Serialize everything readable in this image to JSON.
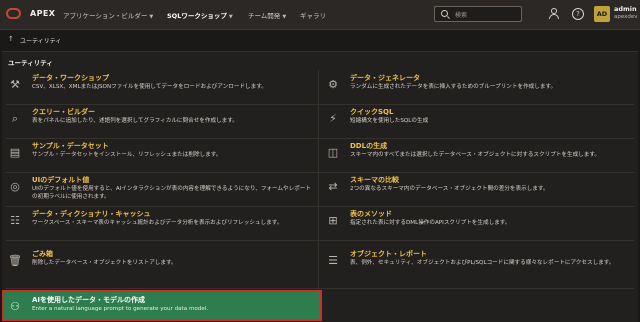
{
  "header": {
    "brand": "APEX",
    "nav": [
      {
        "label": "アプリケーション・ビルダー",
        "has_menu": true,
        "active": false
      },
      {
        "label": "SQLワークショップ",
        "has_menu": true,
        "active": true
      },
      {
        "label": "チーム開発",
        "has_menu": true,
        "active": false
      },
      {
        "label": "ギャラリ",
        "has_menu": false,
        "active": false
      }
    ],
    "search_placeholder": "検索",
    "user": {
      "initials": "AD",
      "name": "admin",
      "workspace": "apexdev"
    }
  },
  "breadcrumb": {
    "label": "ユーティリティ"
  },
  "region": {
    "title": "ユーティリティ",
    "cards": [
      {
        "icon": "toolbox-icon",
        "glyph": "⚒",
        "title": "データ・ワークショップ",
        "desc": "CSV、XLSX、XMLまたはJSONファイルを使用してデータをロードおよびアンロードします。"
      },
      {
        "icon": "data-generator-icon",
        "glyph": "⚙",
        "title": "データ・ジェネレータ",
        "desc": "ランダムに生成されたデータを表に挿入するためのブループリントを作成します。"
      },
      {
        "icon": "query-builder-icon",
        "glyph": "⌕",
        "title": "クエリー・ビルダー",
        "desc": "表をパネルに追加したり、述語列を選択してグラフィカルに問合せを作成します。"
      },
      {
        "icon": "quick-sql-icon",
        "glyph": "⚡",
        "title": "クイックSQL",
        "desc": "短縮構文を使用したSQLの生成"
      },
      {
        "icon": "sample-dataset-icon",
        "glyph": "▤",
        "title": "サンプル・データセット",
        "desc": "サンプル・データセットをインストール、リフレッシュまたは削除します。"
      },
      {
        "icon": "ddl-icon",
        "glyph": "◫",
        "title": "DDLの生成",
        "desc": "スキーマ内のすべてまたは選択したデータベース・オブジェクトに対するスクリプトを生成します。"
      },
      {
        "icon": "ui-defaults-icon",
        "glyph": "◎",
        "title": "UIのデフォルト値",
        "desc": "UIのデフォルト値を使用すると、AIインタラクションが表の内容を理解できるようになり、フォームやレポートの初期ラベルに使用されます。"
      },
      {
        "icon": "schema-compare-icon",
        "glyph": "⇄",
        "title": "スキーマの比較",
        "desc": "2つの異なるスキーマ内のデータベース・オブジェクト間の差分を表示します。"
      },
      {
        "icon": "data-dictionary-cache-icon",
        "glyph": "☷",
        "title": "データ・ディクショナリ・キャッシュ",
        "desc": "ワークスペース・スキーマ表のキャッシュ統計およびデータ分析を表示およびリフレッシュします。"
      },
      {
        "icon": "table-methods-icon",
        "glyph": "⊞",
        "title": "表のメソッド",
        "desc": "指定された表に対するDML操作のAPIスクリプトを生成します。"
      },
      {
        "icon": "recycle-bin-icon",
        "glyph": "🗑",
        "title": "ごみ箱",
        "desc": "削除したデータベース・オブジェクトをリストアします。"
      },
      {
        "icon": "object-report-icon",
        "glyph": "☰",
        "title": "オブジェクト・レポート",
        "desc": "表、例外、セキュリティ、オブジェクトおよびPL/SQLコードに関する様々なレポートにアクセスします。"
      },
      {
        "icon": "ai-data-model-icon",
        "glyph": "⚇",
        "title": "AIを使用したデータ・モデルの作成",
        "desc": "Enter a natural language prompt to generate your data model."
      }
    ]
  }
}
